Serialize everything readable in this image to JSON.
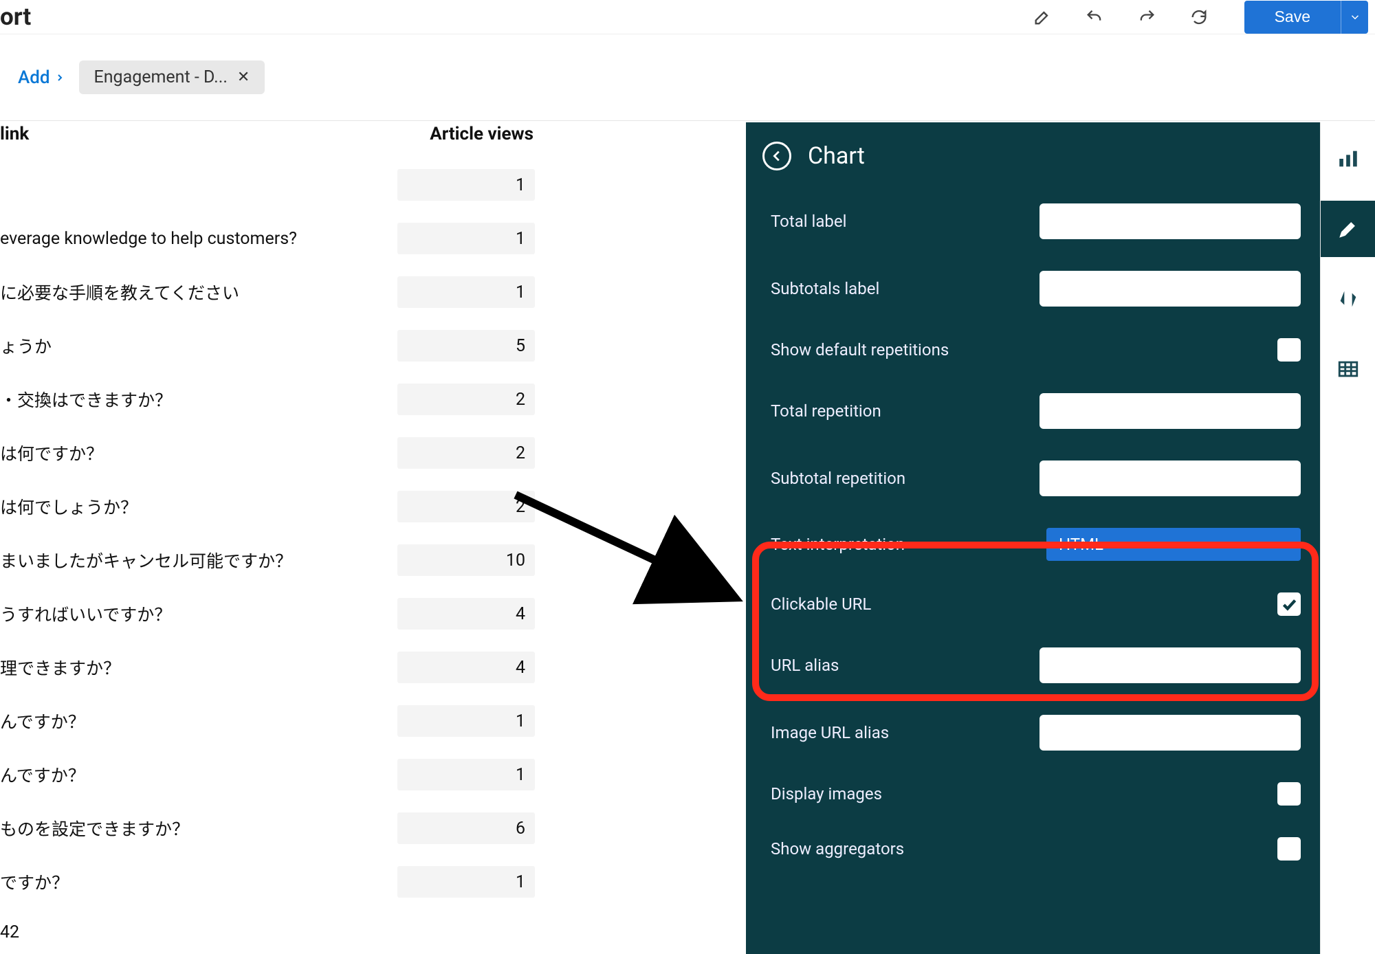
{
  "header": {
    "title_fragment": "ort",
    "save_label": "Save"
  },
  "chips": {
    "add_label": "Add",
    "pill_label": "Engagement - D..."
  },
  "table": {
    "col1_header": "link",
    "col2_header": "Article views",
    "rows": [
      {
        "link": "",
        "views": "1"
      },
      {
        "link": "everage knowledge to help customers?",
        "views": "1"
      },
      {
        "link": "に必要な手順を教えてください",
        "views": "1"
      },
      {
        "link": "ょうか",
        "views": "5"
      },
      {
        "link": "・交換はできますか？",
        "views": "2"
      },
      {
        "link": "は何ですか？",
        "views": "2"
      },
      {
        "link": "は何でしょうか？",
        "views": "2"
      },
      {
        "link": "まいましたがキャンセル可能ですか？",
        "views": "10"
      },
      {
        "link": "うすればいいですか？",
        "views": "4"
      },
      {
        "link": "理できますか？",
        "views": "4"
      },
      {
        "link": "んですか？",
        "views": "1"
      },
      {
        "link": "んですか？",
        "views": "1"
      },
      {
        "link": "ものを設定できますか？",
        "views": "6"
      },
      {
        "link": "ですか？",
        "views": "1"
      }
    ],
    "total": "42"
  },
  "panel": {
    "title": "Chart",
    "fields": {
      "total_label": "Total label",
      "subtotals_label": "Subtotals label",
      "show_default_repetitions": "Show default repetitions",
      "total_repetition": "Total repetition",
      "subtotal_repetition": "Subtotal repetition",
      "text_interpretation": "Text interpretation",
      "text_interpretation_value": "HTML",
      "clickable_url": "Clickable URL",
      "url_alias": "URL alias",
      "image_url_alias": "Image URL alias",
      "display_images": "Display images",
      "show_aggregators": "Show aggregators"
    },
    "checkboxes": {
      "show_default_repetitions": false,
      "clickable_url": true,
      "display_images": false,
      "show_aggregators": false
    }
  }
}
